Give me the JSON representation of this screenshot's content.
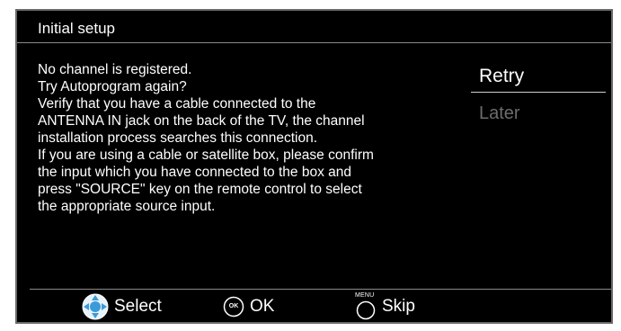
{
  "dialog": {
    "title": "Initial setup",
    "message_lines": [
      "No channel is registered.",
      "Try Autoprogram again?",
      "Verify that you have a cable connected to the",
      "ANTENNA IN jack on the back of the TV, the channel",
      "installation process searches this connection.",
      "If you are using a cable or satellite box, please confirm",
      "the input which you have connected to  the box and",
      "press \"SOURCE\" key on the remote control to select",
      "the appropriate source input."
    ],
    "options": {
      "retry": "Retry",
      "later": "Later"
    }
  },
  "footer": {
    "select_label": "Select",
    "select_icon": "dpad-icon",
    "ok_label": "OK",
    "ok_icon_text": "OK",
    "skip_label": "Skip",
    "skip_icon_caption": "MENU"
  },
  "colors": {
    "background": "#000000",
    "text": "#ffffff",
    "disabled_text": "#6c6c6c",
    "border": "#6a6a6a"
  }
}
